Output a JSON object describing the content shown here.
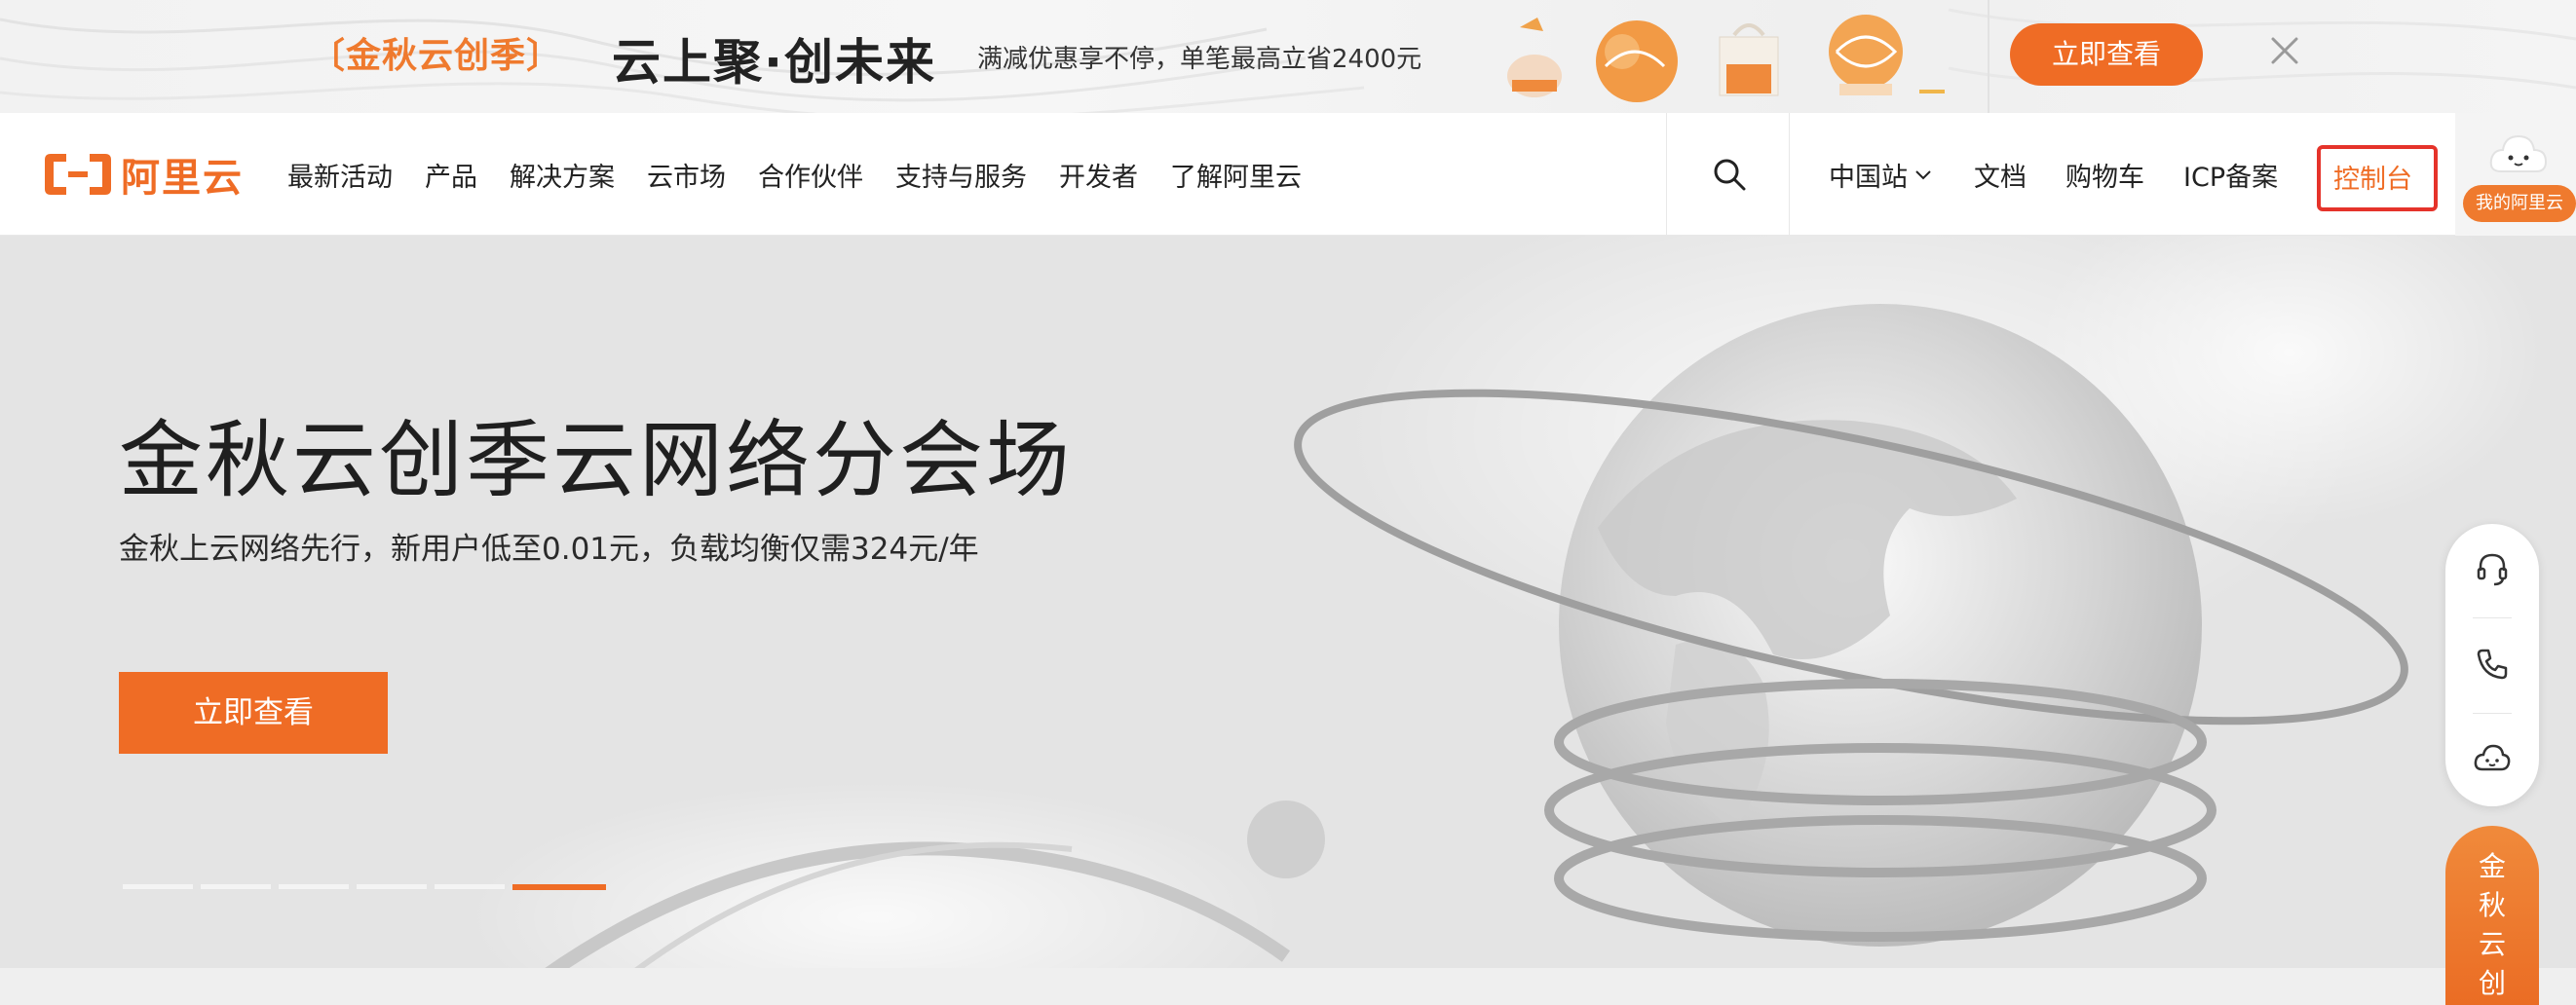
{
  "promo": {
    "tag": "〔金秋云创季〕",
    "title": "云上聚·创未来",
    "desc": "满减优惠享不停，单笔最高立省2400元",
    "button": "立即查看",
    "close_icon": "close-icon"
  },
  "nav": {
    "logo_text": "阿里云",
    "items": [
      "最新活动",
      "产品",
      "解决方案",
      "云市场",
      "合作伙伴",
      "支持与服务",
      "开发者",
      "了解阿里云"
    ],
    "search_icon": "search-icon",
    "right": {
      "site": "中国站",
      "docs": "文档",
      "cart": "购物车",
      "icp": "ICP备案",
      "console": "控制台"
    },
    "annotation": "1",
    "my_badge": "我的阿里云"
  },
  "hero": {
    "title": "金秋云创季云网络分会场",
    "subtitle": "金秋上云网络先行，新用户低至0.01元，负载均衡仅需324元/年",
    "button": "立即查看",
    "carousel": {
      "count": 6,
      "active_index": 5
    }
  },
  "side": {
    "tools": [
      "headset-icon",
      "phone-icon",
      "chat-bot-icon"
    ],
    "promo_text": "金秋云创季"
  },
  "colors": {
    "brand_orange": "#ef6c25",
    "annotation_red": "#e5332a"
  }
}
